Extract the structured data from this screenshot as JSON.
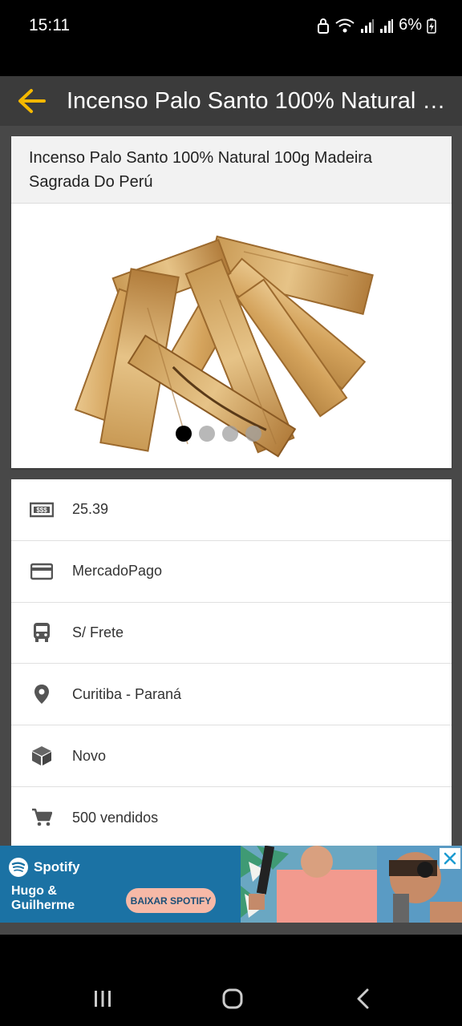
{
  "status_bar": {
    "time": "15:11",
    "battery": "6%"
  },
  "app_bar": {
    "title": "Incenso Palo Santo 100% Natural 100g Madeira Sagrada Do Perú",
    "back_icon": "arrow-left-icon",
    "accent_color": "#f5b800"
  },
  "product": {
    "title": "Incenso Palo Santo 100% Natural 100g Madeira Sagrada Do Perú",
    "image_count": 4,
    "active_image": 1
  },
  "info": {
    "rows": [
      {
        "icon": "money-icon",
        "text": "25.39"
      },
      {
        "icon": "credit-card-icon",
        "text": "MercadoPago"
      },
      {
        "icon": "bus-icon",
        "text": "S/ Frete"
      },
      {
        "icon": "location-pin-icon",
        "text": "Curitiba - Paraná"
      },
      {
        "icon": "box-icon",
        "text": "Novo"
      },
      {
        "icon": "cart-icon",
        "text": "500 vendidos"
      }
    ]
  },
  "ad": {
    "brand": "Spotify",
    "artist_line1": "Hugo &",
    "artist_line2": "Guilherme",
    "cta": "BAIXAR SPOTIFY",
    "close_icon": "close-icon"
  },
  "nav_bar": {
    "recents_icon": "recents-icon",
    "home_icon": "home-icon",
    "back_icon": "nav-back-icon"
  }
}
